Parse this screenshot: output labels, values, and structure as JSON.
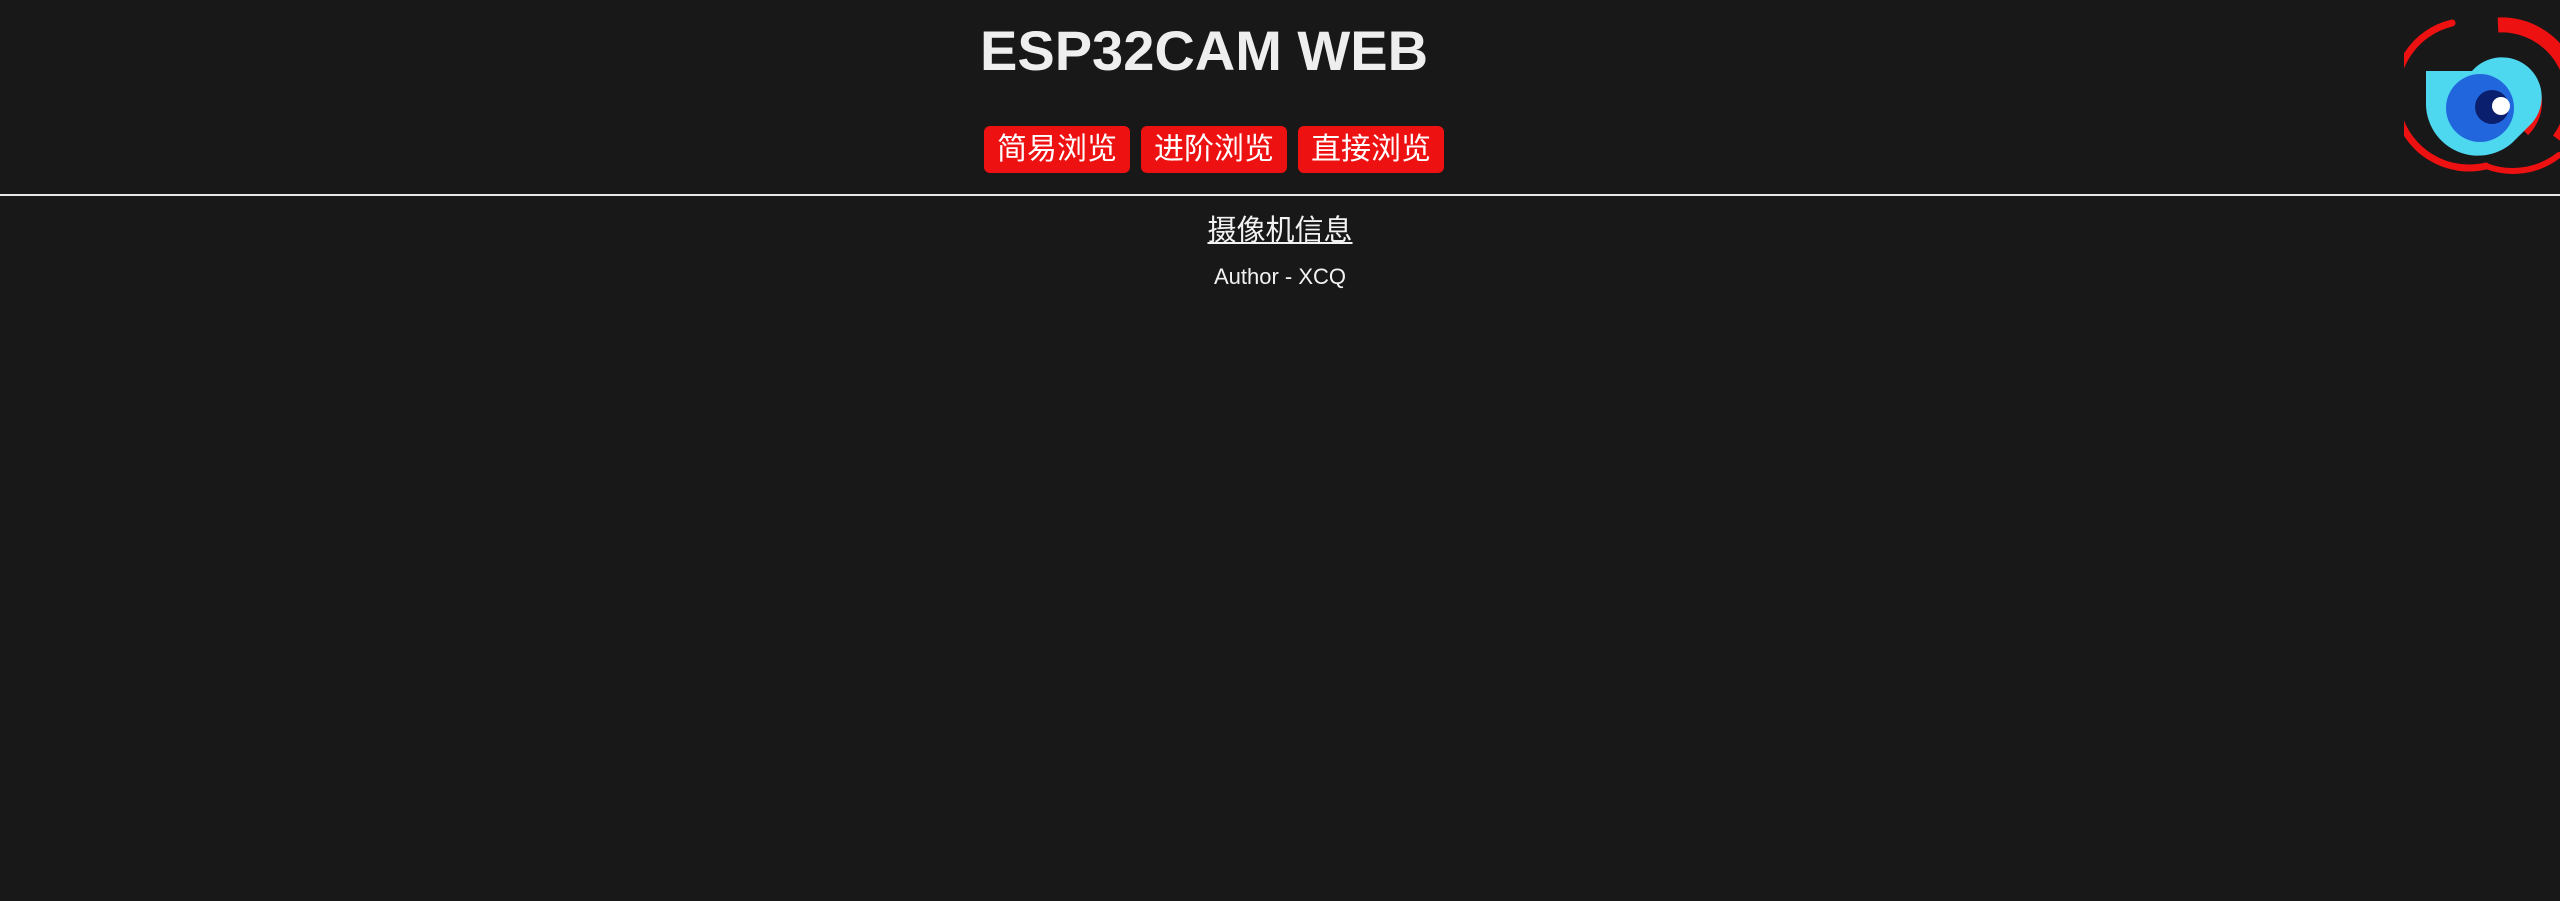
{
  "header": {
    "title": "ESP32CAM WEB",
    "nav": [
      {
        "label": "简易浏览"
      },
      {
        "label": "进阶浏览"
      },
      {
        "label": "直接浏览"
      }
    ],
    "logo_icon": "eye-camera-icon"
  },
  "main": {
    "info_link": "摄像机信息",
    "author": "Author - XCQ"
  },
  "colors": {
    "background": "#181818",
    "accent": "#ee1111",
    "text": "#eeeeee"
  }
}
